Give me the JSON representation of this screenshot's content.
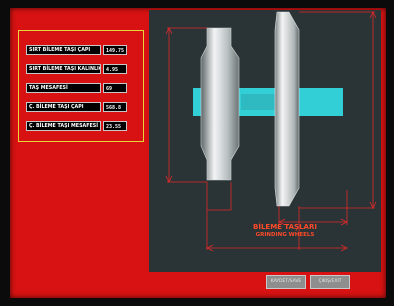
{
  "params": [
    {
      "label": "SIRT BİLEME TAŞI ÇAPI",
      "value": "149.75"
    },
    {
      "label": "SIRT BİLEME TAŞI KALINLIĞI",
      "value": "4.95"
    },
    {
      "label": "TAŞ MESAFESİ",
      "value": "69"
    },
    {
      "label": "Ç. BİLEME TAŞI ÇAPI",
      "value": "568.8"
    },
    {
      "label": "Ç. BİLEME TAŞI MESAFESİ",
      "value": "23.55"
    }
  ],
  "caption": {
    "line1": "BİLEME TAŞLARI",
    "line2": "GRINDING WHEELS"
  },
  "buttons": {
    "left": "KAYDET/SAVE",
    "right": "ÇIKIŞ/EXIT"
  },
  "colors": {
    "panel": "#d81212",
    "diagram_bg": "#2a3336",
    "shaft": "#33cfd6",
    "dimension": "#e02a2a",
    "frame": "#e6d43a"
  }
}
